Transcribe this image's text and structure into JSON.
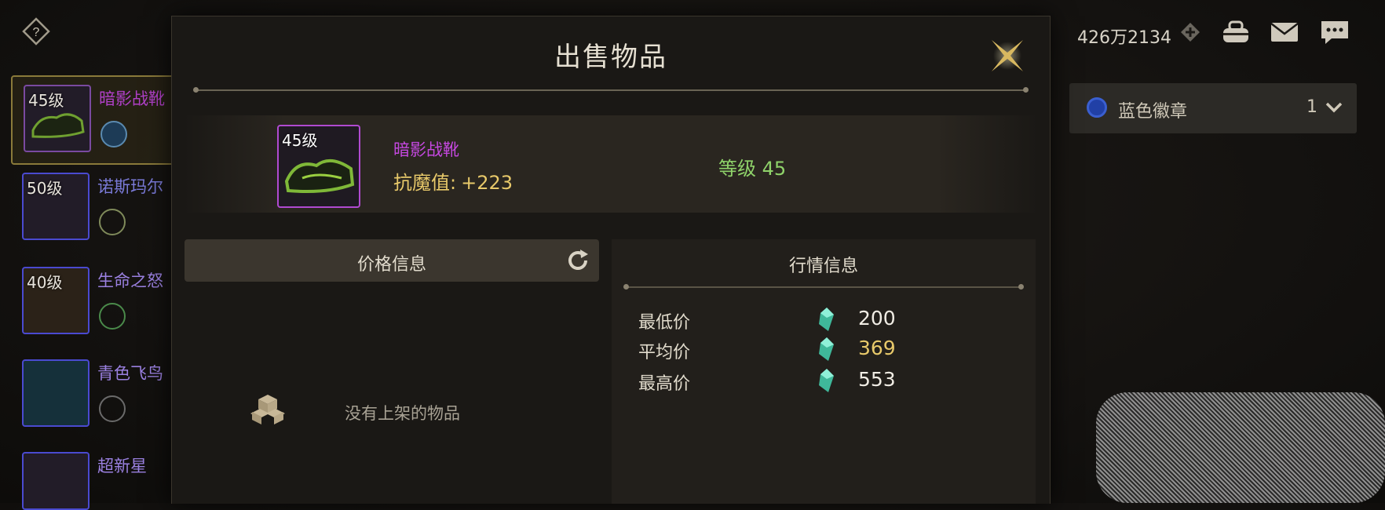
{
  "topbar": {
    "currency": "426万2134"
  },
  "left_list": [
    {
      "level": "45级",
      "name": "暗影战靴",
      "name_color": "#b040c8"
    },
    {
      "level": "50级",
      "name": "诺斯玛尔",
      "name_color": "#7a7ad8"
    },
    {
      "level": "40级",
      "name": "生命之怒",
      "name_color": "#9a80e0"
    },
    {
      "level": "",
      "name": "青色飞鸟",
      "name_color": "#9a80e0"
    },
    {
      "level": "",
      "name": "超新星",
      "name_color": "#9a80e0"
    }
  ],
  "right_panel": {
    "badge_label": "蓝色徽章",
    "badge_count": "1"
  },
  "modal": {
    "title": "出售物品",
    "item": {
      "level": "45级",
      "name": "暗影战靴",
      "stat_label": "抗魔值:",
      "stat_value": "+223",
      "level_req": "等级 45"
    },
    "price_section": {
      "title": "价格信息",
      "empty_text": "没有上架的物品"
    },
    "market_section": {
      "title": "行情信息",
      "rows": [
        {
          "label": "最低价",
          "value": "200"
        },
        {
          "label": "平均价",
          "value": "369"
        },
        {
          "label": "最高价",
          "value": "553"
        }
      ]
    }
  },
  "colors": {
    "rarity_purple": "#c548e0",
    "stat_gold": "#e8c96a",
    "level_green": "#8fd36a",
    "gem_teal": "#4fd0b0"
  }
}
